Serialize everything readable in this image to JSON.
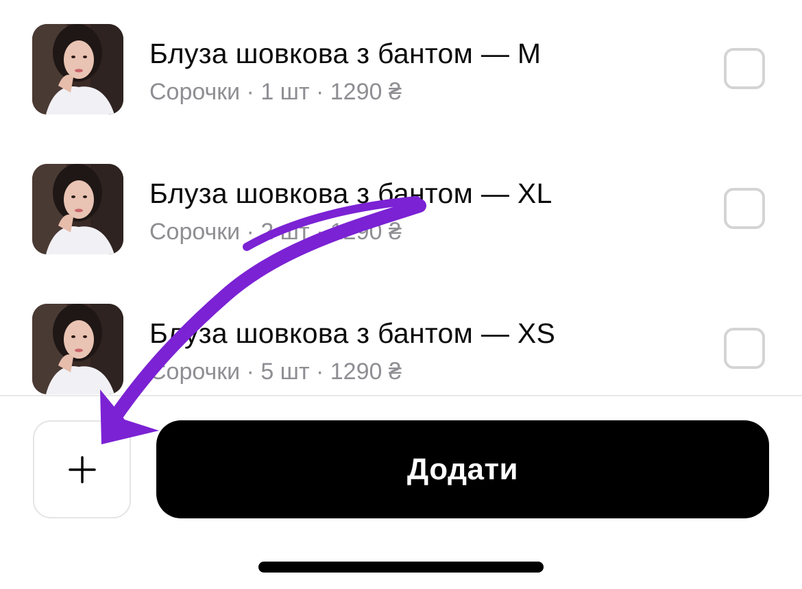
{
  "items": [
    {
      "title": "Блуза шовкова з бантом — M",
      "meta": "Сорочки · 1 шт · 1290 ₴",
      "checked": false
    },
    {
      "title": "Блуза шовкова з бантом — XL",
      "meta": "Сорочки · 2 шт · 1290 ₴",
      "checked": false
    },
    {
      "title": "Блуза шовкова з бантом — XS",
      "meta": "Сорочки · 5 шт · 1290 ₴",
      "checked": false
    }
  ],
  "footer": {
    "plus_icon": "plus-icon",
    "add_label": "Додати"
  },
  "annotation": {
    "color": "#7b22d4",
    "icon": "curved-arrow-pointing-to-plus-button"
  }
}
